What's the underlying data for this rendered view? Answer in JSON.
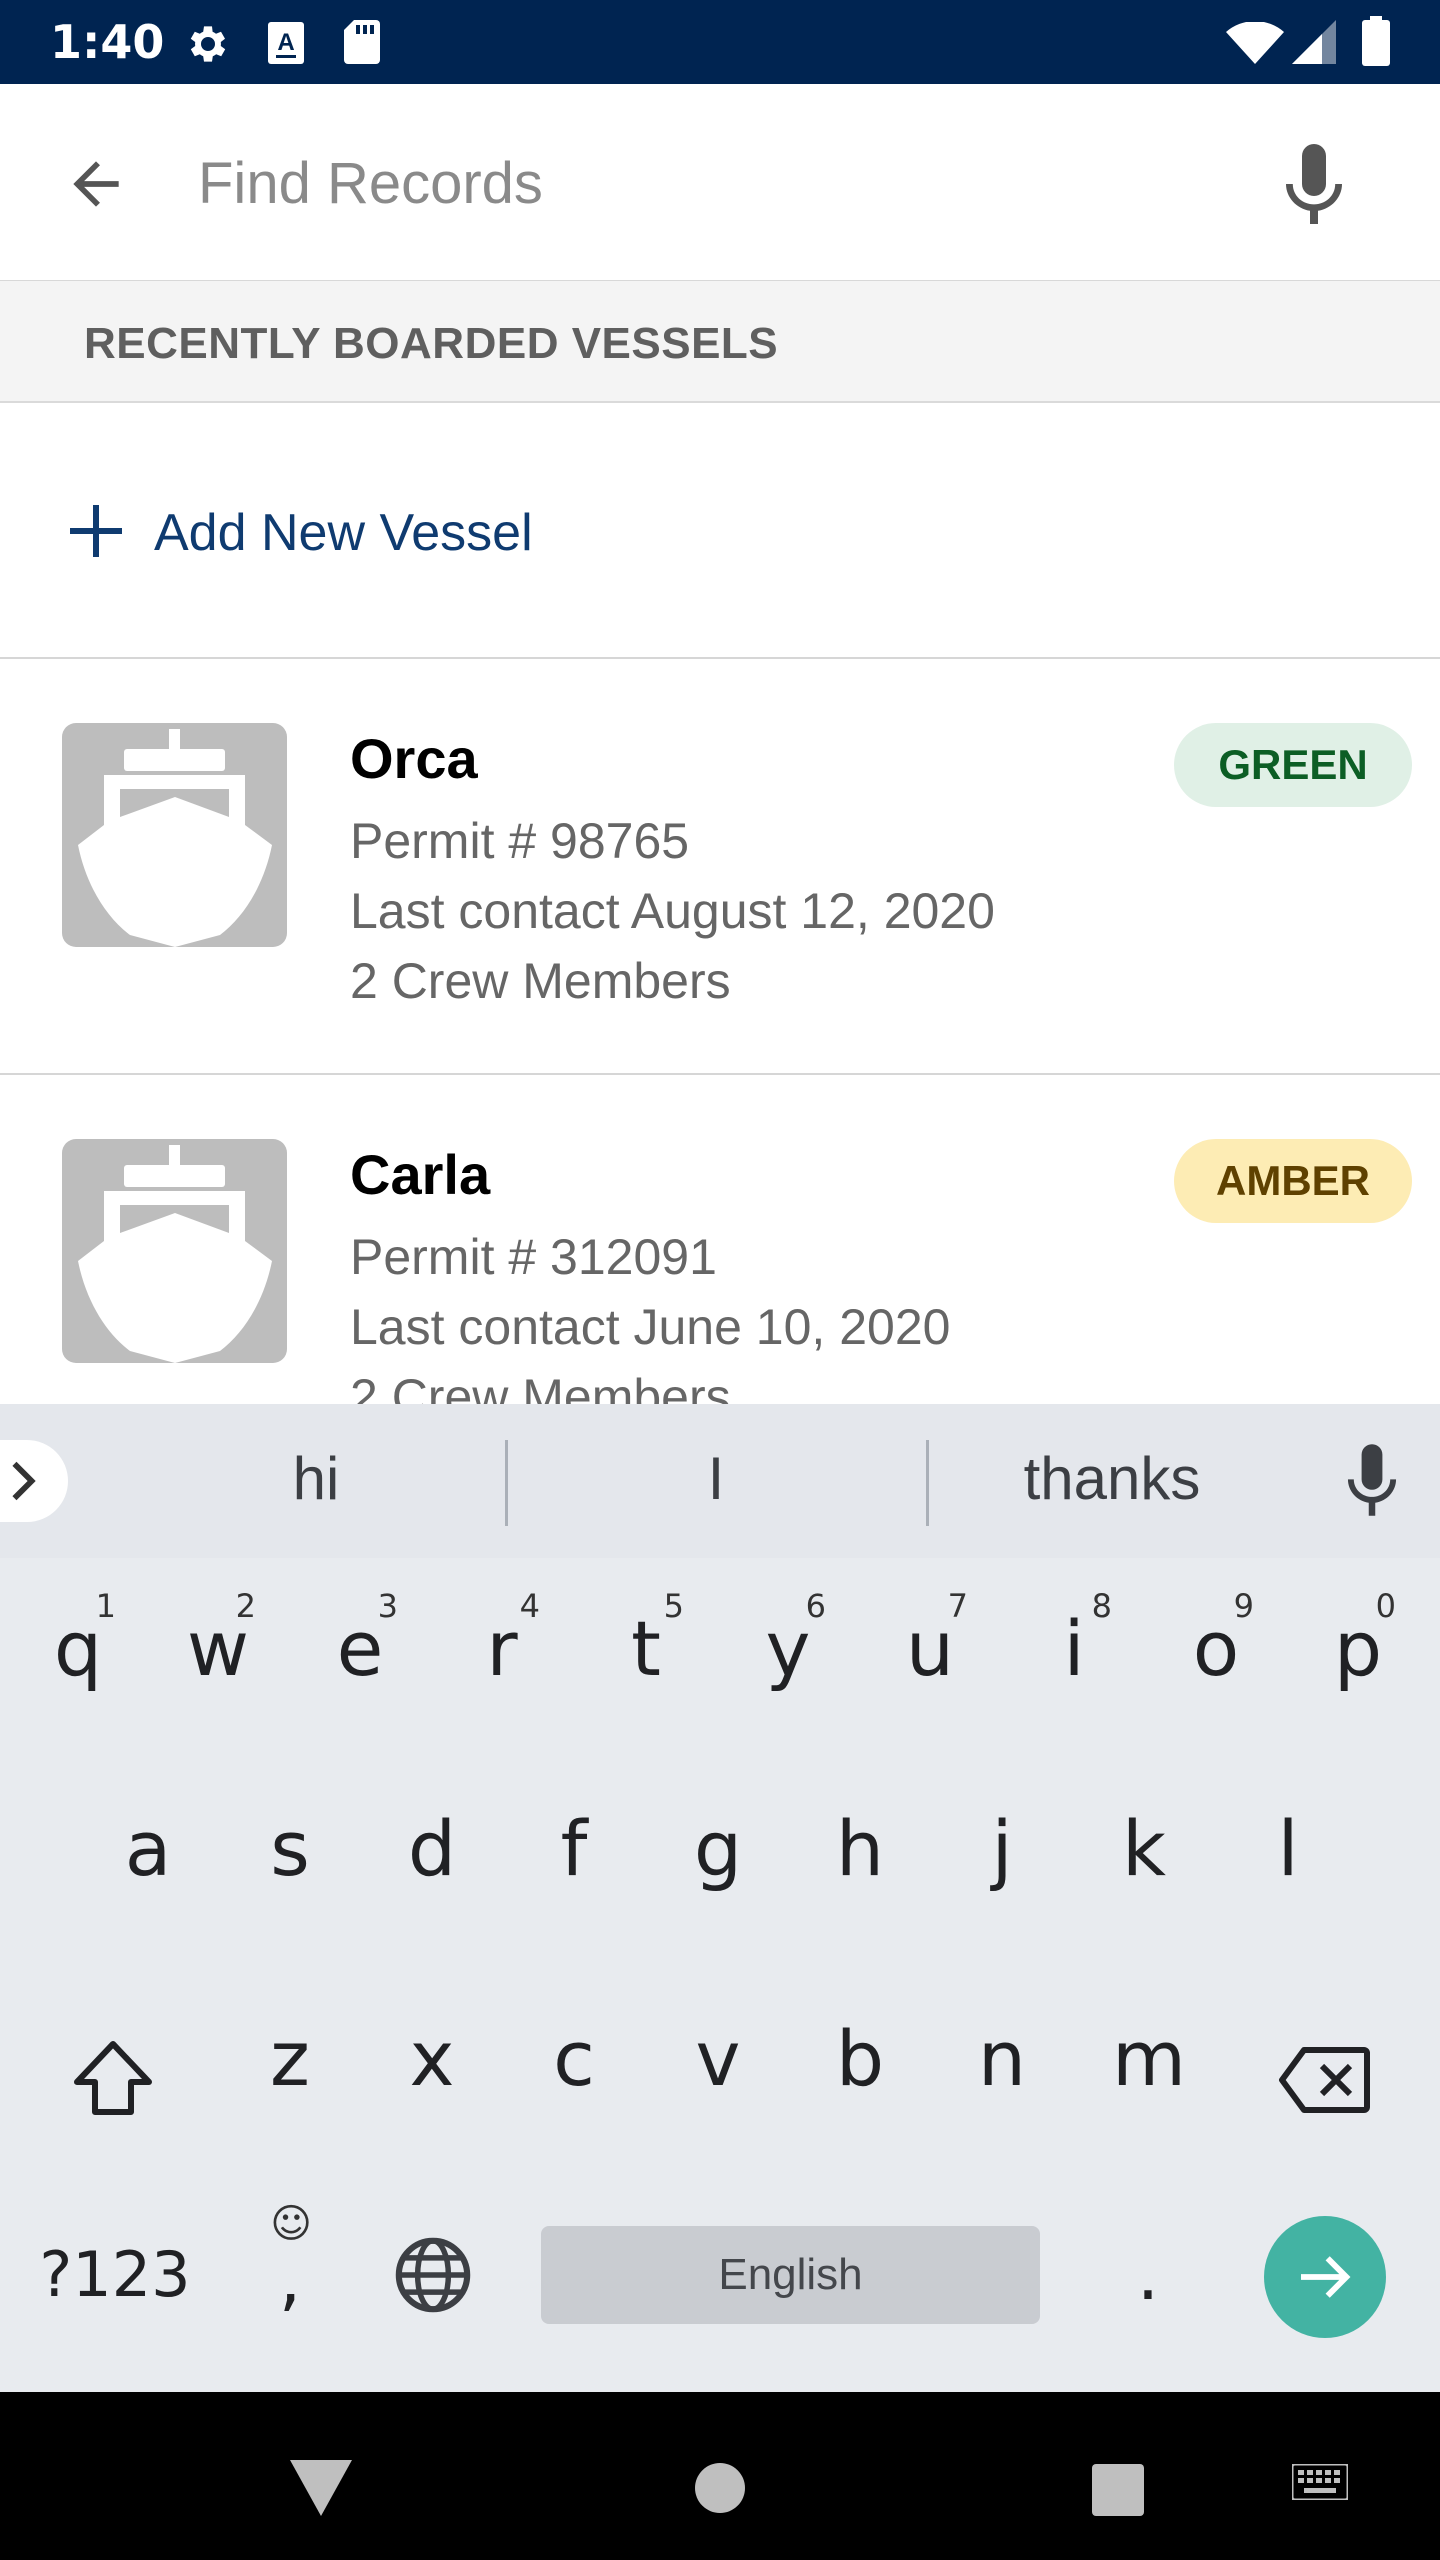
{
  "status_bar": {
    "time": "1:40",
    "icons": [
      "settings-icon",
      "accessibility-a-icon",
      "sd-card-icon",
      "wifi-icon",
      "signal-icon",
      "battery-icon"
    ]
  },
  "search": {
    "placeholder": "Find Records",
    "value": ""
  },
  "section_header": "RECENTLY BOARDED VESSELS",
  "add_vessel_label": "Add New Vessel",
  "vessels": [
    {
      "name": "Orca",
      "permit": "Permit # 98765",
      "last_contact": "Last contact August 12, 2020",
      "crew": "2 Crew Members",
      "status": "GREEN"
    },
    {
      "name": "Carla",
      "permit": "Permit # 312091",
      "last_contact": "Last contact June 10, 2020",
      "crew": "2 Crew Members",
      "status": "AMBER"
    }
  ],
  "keyboard": {
    "suggestions": [
      "hi",
      "I",
      "thanks"
    ],
    "row1": [
      {
        "k": "q",
        "n": "1"
      },
      {
        "k": "w",
        "n": "2"
      },
      {
        "k": "e",
        "n": "3"
      },
      {
        "k": "r",
        "n": "4"
      },
      {
        "k": "t",
        "n": "5"
      },
      {
        "k": "y",
        "n": "6"
      },
      {
        "k": "u",
        "n": "7"
      },
      {
        "k": "i",
        "n": "8"
      },
      {
        "k": "o",
        "n": "9"
      },
      {
        "k": "p",
        "n": "0"
      }
    ],
    "row2": [
      "a",
      "s",
      "d",
      "f",
      "g",
      "h",
      "j",
      "k",
      "l"
    ],
    "row3": [
      "z",
      "x",
      "c",
      "v",
      "b",
      "n",
      "m"
    ],
    "symbols_label": "?123",
    "comma_label": ",",
    "emoji_label": "☺",
    "space_label": "English",
    "period_label": "."
  },
  "colors": {
    "status_bar": "#002451",
    "accent_link": "#0f3b70",
    "green_badge_bg": "#e0f0e6",
    "amber_badge_bg": "#fdecb4",
    "enter_key": "#43b3a3"
  }
}
